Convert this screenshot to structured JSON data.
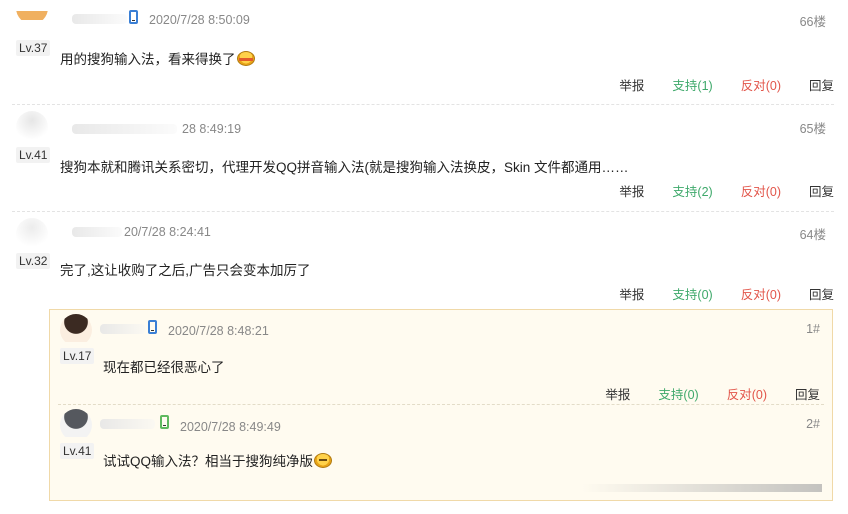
{
  "colors": {
    "support": "#3fa96b",
    "oppose": "#e2554a",
    "device_blue": "#3a7fd5",
    "device_green": "#5fb95f",
    "quote_bg": "#fffbf0"
  },
  "comments": [
    {
      "level": "Lv.37",
      "time": "2020/7/28 8:50:09",
      "floor": "66楼",
      "text": "用的搜狗输入法，看来得换了",
      "emoji": "burger-emoji",
      "device": "phone-icon",
      "actions": {
        "report": "举报",
        "support": "支持(1)",
        "oppose": "反对(0)",
        "reply": "回复"
      }
    },
    {
      "level": "Lv.41",
      "time": "28 8:49:19",
      "floor": "65楼",
      "text": "搜狗本就和腾讯关系密切，代理开发QQ拼音输入法(就是搜狗输入法换皮，Skin 文件都通用……",
      "actions": {
        "report": "举报",
        "support": "支持(2)",
        "oppose": "反对(0)",
        "reply": "回复"
      }
    },
    {
      "level": "Lv.32",
      "time": "20/7/28 8:24:41",
      "floor": "64楼",
      "text": "完了,这让收购了之后,广告只会变本加厉了",
      "actions": {
        "report": "举报",
        "support": "支持(0)",
        "oppose": "反对(0)",
        "reply": "回复"
      }
    }
  ],
  "replies": [
    {
      "level": "Lv.17",
      "time": "2020/7/28 8:48:21",
      "floor": "1#",
      "text": "现在都已经很恶心了",
      "device": "phone-icon",
      "actions": {
        "report": "举报",
        "support": "支持(0)",
        "oppose": "反对(0)",
        "reply": "回复"
      }
    },
    {
      "level": "Lv.41",
      "time": "2020/7/28 8:49:49",
      "floor": "2#",
      "text": "试试QQ输入法？相当于搜狗纯净版",
      "emoji": "cat-emoji",
      "device": "android-phone-icon"
    }
  ]
}
